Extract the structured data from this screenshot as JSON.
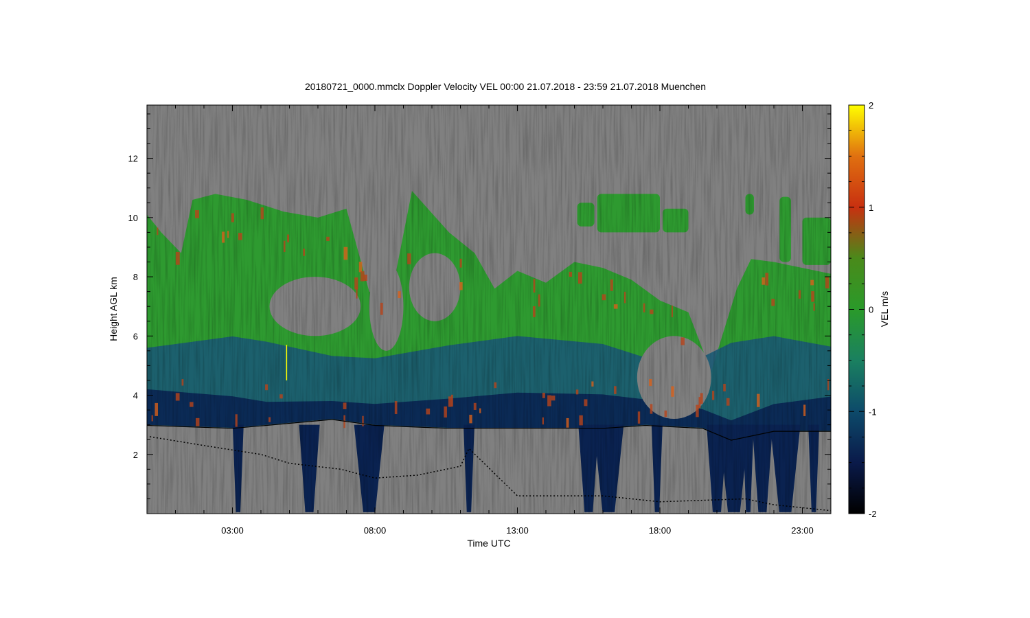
{
  "chart_data": {
    "type": "heatmap",
    "title": "20180721_0000.mmclx Doppler Velocity VEL   00:00 21.07.2018 - 23:59 21.07.2018 Muenchen",
    "xlabel": "Time UTC",
    "ylabel": "Height AGL km",
    "colorbar_label": "VEL m/s",
    "x_range_hours": [
      0.0,
      24.0
    ],
    "y_range_km": [
      0.0,
      13.8
    ],
    "x_ticks": [
      {
        "label": "03:00",
        "hour": 3
      },
      {
        "label": "08:00",
        "hour": 8
      },
      {
        "label": "13:00",
        "hour": 13
      },
      {
        "label": "18:00",
        "hour": 18
      },
      {
        "label": "23:00",
        "hour": 23
      }
    ],
    "y_ticks": [
      2,
      4,
      6,
      8,
      10,
      12
    ],
    "colorbar_range": [
      -2,
      2
    ],
    "colorbar_ticks": [
      -2,
      -1,
      0,
      1,
      2
    ],
    "colorscale": [
      "#000000",
      "#0a1a4a",
      "#0d4a6a",
      "#1a8060",
      "#2a9a2a",
      "#4a8a1a",
      "#c83010",
      "#e07010",
      "#ffff00"
    ],
    "no_signal_color": "#808080",
    "cloud_top_km": [
      [
        0,
        10.1
      ],
      [
        0.5,
        9.5
      ],
      [
        1.2,
        8.8
      ],
      [
        1.6,
        10.6
      ],
      [
        2.4,
        10.8
      ],
      [
        3.5,
        10.6
      ],
      [
        4.8,
        10.2
      ],
      [
        6,
        10.0
      ],
      [
        7,
        10.3
      ],
      [
        7.8,
        7.5
      ],
      [
        8.5,
        7.0
      ],
      [
        9.3,
        10.9
      ],
      [
        10.6,
        9.5
      ],
      [
        11.5,
        8.8
      ],
      [
        12.2,
        7.6
      ],
      [
        13,
        8.2
      ],
      [
        14,
        7.8
      ],
      [
        15,
        8.5
      ],
      [
        16,
        8.3
      ],
      [
        17,
        7.9
      ],
      [
        18,
        7.2
      ],
      [
        19,
        6.8
      ],
      [
        19.8,
        4.8
      ],
      [
        20.7,
        7.6
      ],
      [
        21.2,
        8.6
      ],
      [
        22,
        8.5
      ],
      [
        23,
        8.3
      ],
      [
        24,
        8.1
      ]
    ],
    "cloud_base_km": [
      [
        0,
        3.0
      ],
      [
        3,
        2.9
      ],
      [
        4.2,
        3.0
      ],
      [
        6.5,
        3.2
      ],
      [
        8,
        3.0
      ],
      [
        10.6,
        2.9
      ],
      [
        13,
        2.9
      ],
      [
        16,
        2.9
      ],
      [
        17.5,
        3.0
      ],
      [
        19.5,
        2.9
      ],
      [
        20.5,
        2.5
      ],
      [
        22,
        2.8
      ],
      [
        24,
        2.8
      ]
    ],
    "dark_layer_top_km": 5.6,
    "fall_streaks_hours": [
      3.2,
      5.7,
      7.8,
      11.3,
      15.5,
      16.2,
      17.9,
      20.0,
      20.6,
      21.1,
      21.6,
      22.4,
      23.4
    ],
    "clear_gaps": [
      {
        "hours": [
          4.3,
          7.5
        ],
        "km": [
          6.0,
          8.0
        ]
      },
      {
        "hours": [
          7.8,
          9.0
        ],
        "km": [
          5.5,
          8.5
        ]
      },
      {
        "hours": [
          9.2,
          11.0
        ],
        "km": [
          6.5,
          8.8
        ]
      },
      {
        "hours": [
          17.2,
          19.8
        ],
        "km": [
          3.2,
          6.0
        ]
      }
    ],
    "upper_patches": [
      {
        "hours": [
          15.1,
          15.7
        ],
        "km": [
          9.7,
          10.5
        ]
      },
      {
        "hours": [
          15.8,
          18.0
        ],
        "km": [
          9.5,
          10.8
        ]
      },
      {
        "hours": [
          18.1,
          19.0
        ],
        "km": [
          9.5,
          10.3
        ]
      },
      {
        "hours": [
          21.0,
          21.3
        ],
        "km": [
          10.1,
          10.8
        ]
      },
      {
        "hours": [
          22.2,
          22.6
        ],
        "km": [
          8.5,
          10.7
        ]
      },
      {
        "hours": [
          23.0,
          24.0
        ],
        "km": [
          8.4,
          10.0
        ]
      }
    ],
    "rain_line_km": [
      [
        0.1,
        2.6
      ],
      [
        2,
        2.3
      ],
      [
        4,
        2.0
      ],
      [
        5,
        1.7
      ],
      [
        6.8,
        1.5
      ],
      [
        8,
        1.2
      ],
      [
        9.5,
        1.3
      ],
      [
        11,
        1.6
      ],
      [
        11.3,
        2.2
      ],
      [
        13,
        0.6
      ],
      [
        16,
        0.6
      ],
      [
        18,
        0.4
      ],
      [
        21,
        0.5
      ],
      [
        22,
        0.3
      ],
      [
        24,
        0.1
      ]
    ]
  }
}
